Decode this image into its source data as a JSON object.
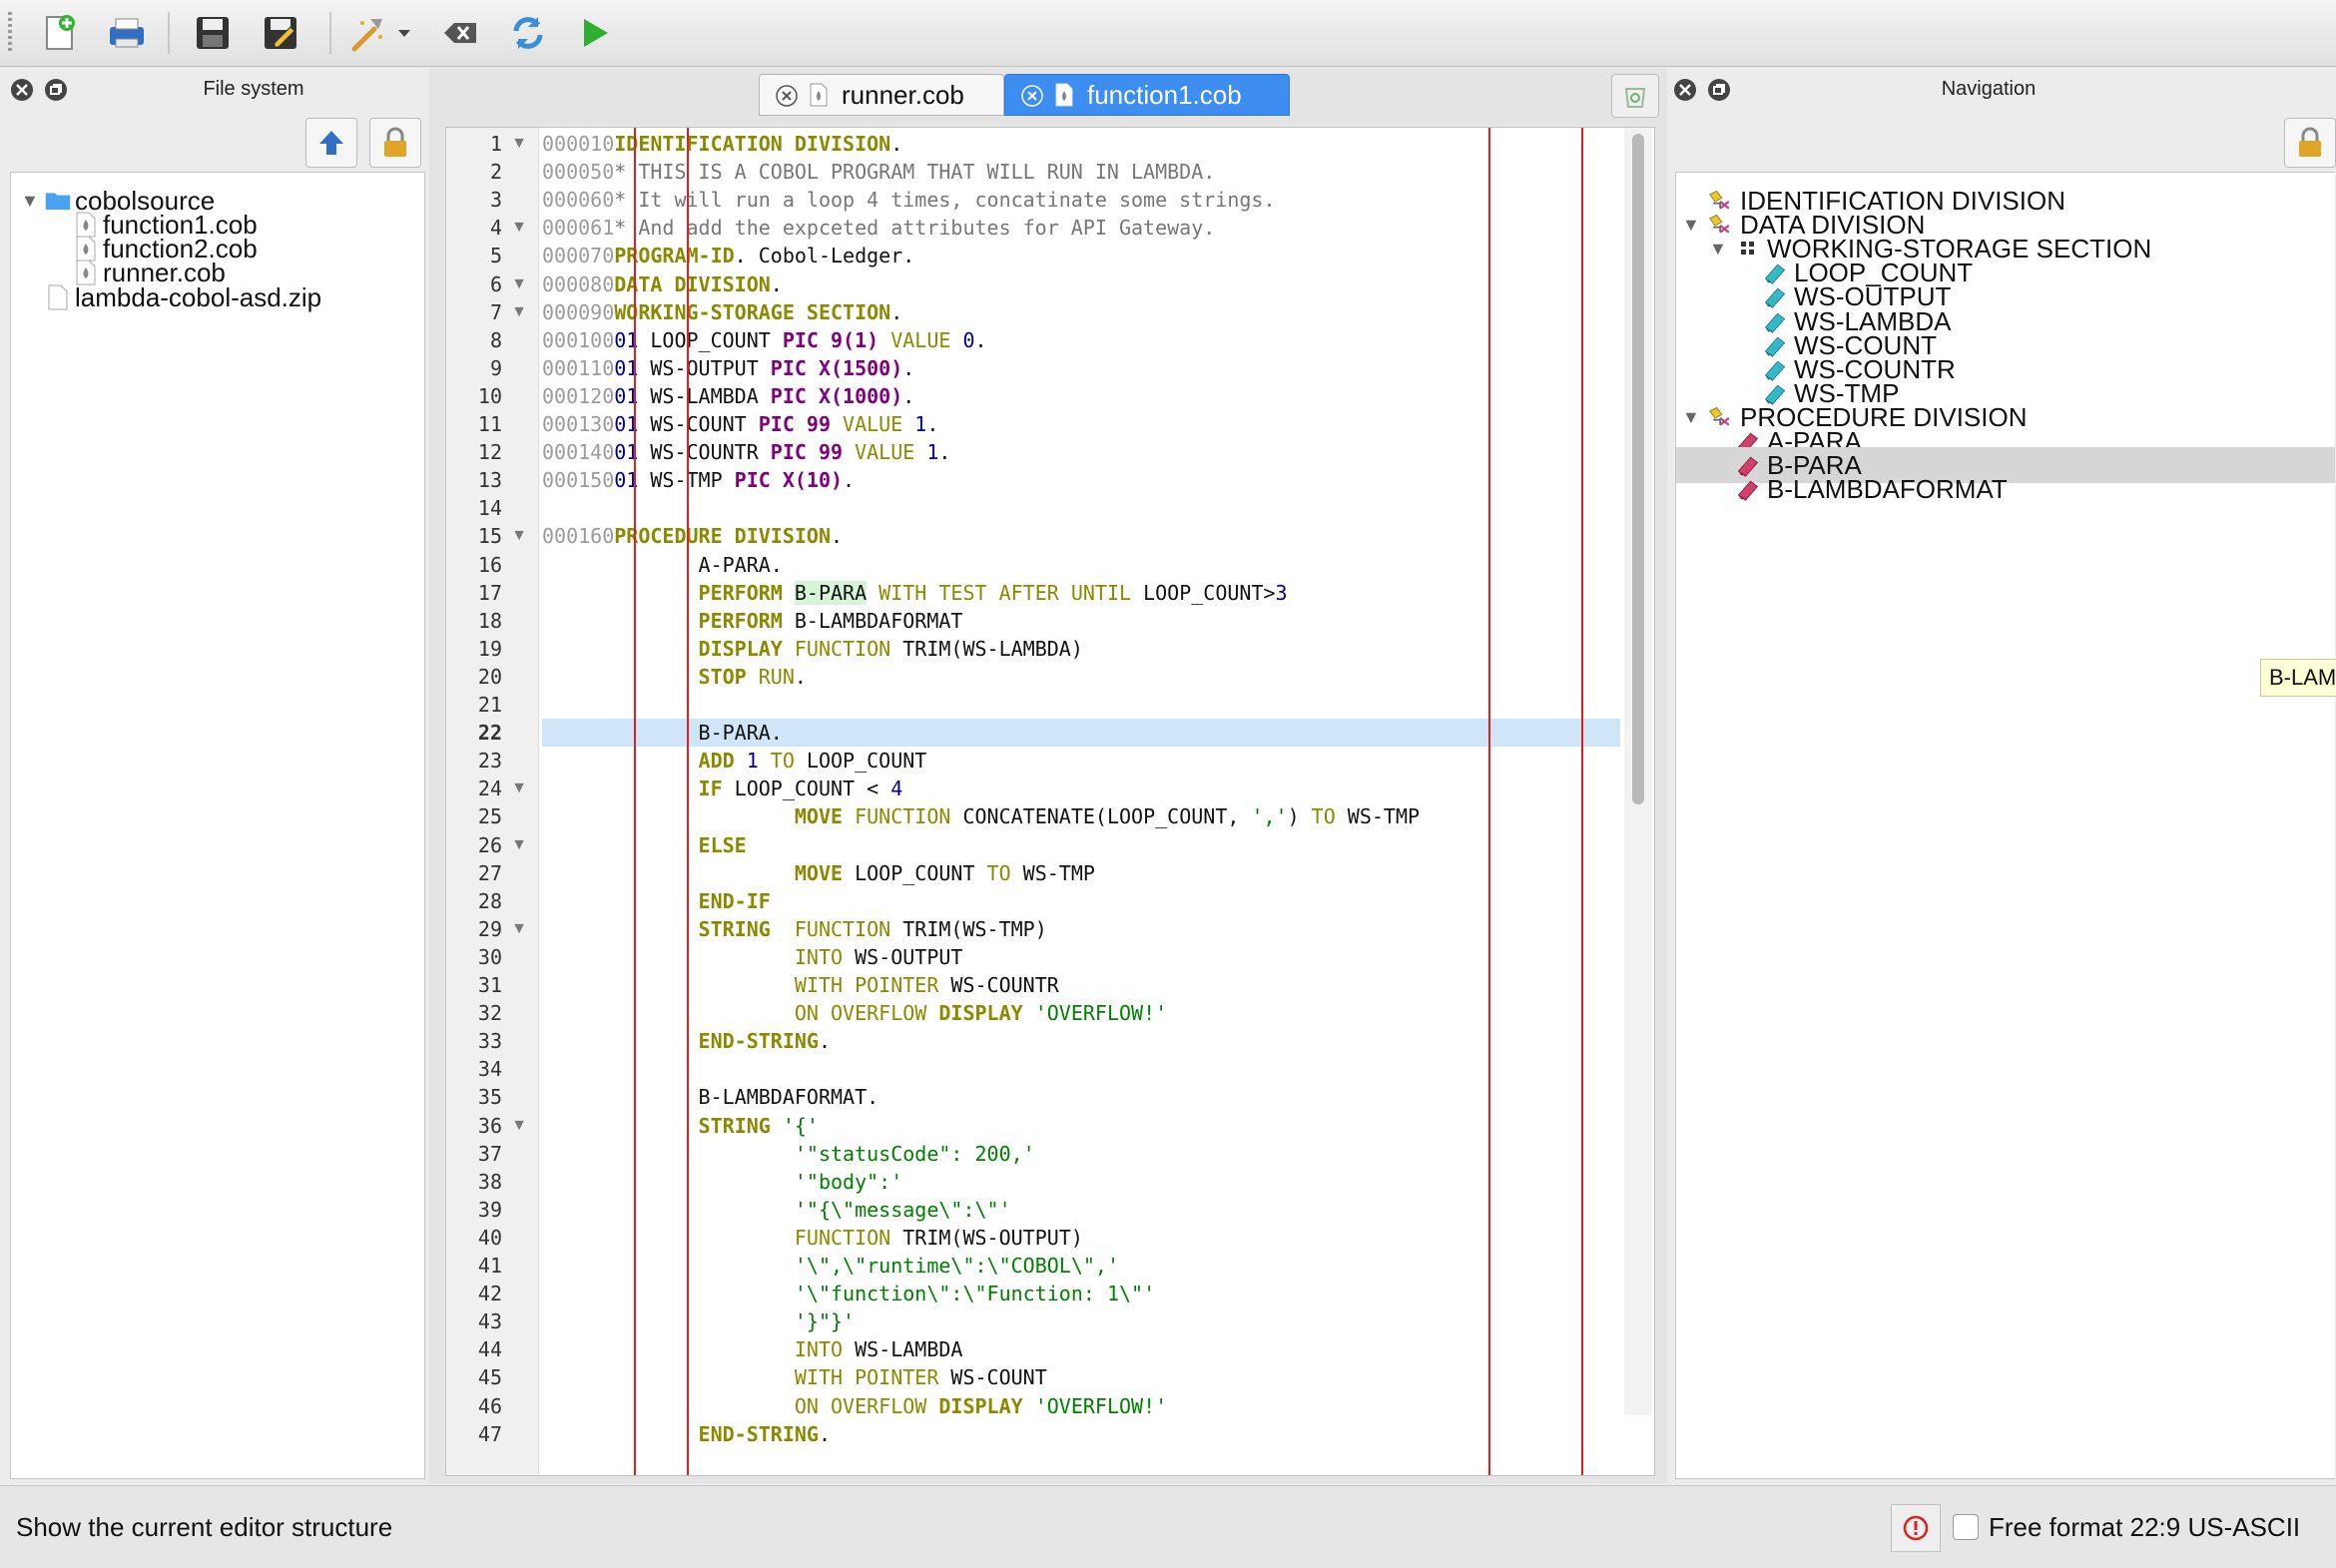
{
  "toolbar": {
    "buttons": [
      "new-file-icon",
      "print-icon",
      "save-icon",
      "save-as-icon",
      "build-icon",
      "dropdown-arrow-icon",
      "clear-icon",
      "refresh-icon",
      "run-icon"
    ]
  },
  "filesystem": {
    "title": "File system",
    "items": [
      {
        "label": "cobolsource",
        "type": "folder",
        "expanded": true,
        "level": 0
      },
      {
        "label": "function1.cob",
        "type": "cobol",
        "level": 1
      },
      {
        "label": "function2.cob",
        "type": "cobol",
        "level": 1
      },
      {
        "label": "runner.cob",
        "type": "cobol",
        "level": 1
      },
      {
        "label": "lambda-cobol-asd.zip",
        "type": "file",
        "level": 0
      }
    ]
  },
  "editor": {
    "tabs": [
      {
        "label": "runner.cob",
        "active": false
      },
      {
        "label": "function1.cob",
        "active": true
      }
    ],
    "current_line": 22,
    "lines": [
      {
        "n": "1",
        "fold": true,
        "seq": "000010",
        "code": [
          [
            "kw",
            "IDENTIFICATION DIVISION"
          ],
          [
            "plain",
            "."
          ]
        ]
      },
      {
        "n": "2",
        "seq": "000050",
        "code": [
          [
            "cm",
            "* THIS IS A COBOL PROGRAM THAT WILL RUN IN LAMBDA."
          ]
        ]
      },
      {
        "n": "3",
        "seq": "000060",
        "code": [
          [
            "cm",
            "* It will run a loop 4 times, concatinate some strings."
          ]
        ]
      },
      {
        "n": "4",
        "fold": true,
        "seq": "000061",
        "code": [
          [
            "cm",
            "* And add the expceted attributes for API Gateway."
          ]
        ]
      },
      {
        "n": "5",
        "seq": "000070",
        "code": [
          [
            "kw",
            "PROGRAM-ID"
          ],
          [
            "plain",
            ". Cobol-Ledger."
          ]
        ]
      },
      {
        "n": "6",
        "fold": true,
        "seq": "000080",
        "code": [
          [
            "kw",
            "DATA DIVISION"
          ],
          [
            "plain",
            "."
          ]
        ]
      },
      {
        "n": "7",
        "fold": true,
        "seq": "000090",
        "code": [
          [
            "kw",
            "WORKING-STORAGE SECTION"
          ],
          [
            "plain",
            "."
          ]
        ]
      },
      {
        "n": "8",
        "seq": "000100",
        "code": [
          [
            "lvl",
            "01"
          ],
          [
            "plain",
            " LOOP_COUNT "
          ],
          [
            "pic",
            "PIC 9(1)"
          ],
          [
            "kw2",
            " VALUE"
          ],
          [
            "num",
            " 0"
          ],
          [
            "plain",
            "."
          ]
        ]
      },
      {
        "n": "9",
        "seq": "000110",
        "code": [
          [
            "lvl",
            "01"
          ],
          [
            "plain",
            " WS-OUTPUT "
          ],
          [
            "pic",
            "PIC X(1500)"
          ],
          [
            "plain",
            "."
          ]
        ]
      },
      {
        "n": "10",
        "seq": "000120",
        "code": [
          [
            "lvl",
            "01"
          ],
          [
            "plain",
            " WS-LAMBDA "
          ],
          [
            "pic",
            "PIC X(1000)"
          ],
          [
            "plain",
            "."
          ]
        ]
      },
      {
        "n": "11",
        "seq": "000130",
        "code": [
          [
            "lvl",
            "01"
          ],
          [
            "plain",
            " WS-COUNT "
          ],
          [
            "pic",
            "PIC 99"
          ],
          [
            "kw2",
            " VALUE"
          ],
          [
            "num",
            " 1"
          ],
          [
            "plain",
            "."
          ]
        ]
      },
      {
        "n": "12",
        "seq": "000140",
        "code": [
          [
            "lvl",
            "01"
          ],
          [
            "plain",
            " WS-COUNTR "
          ],
          [
            "pic",
            "PIC 99"
          ],
          [
            "kw2",
            " VALUE"
          ],
          [
            "num",
            " 1"
          ],
          [
            "plain",
            "."
          ]
        ]
      },
      {
        "n": "13",
        "seq": "000150",
        "code": [
          [
            "lvl",
            "01"
          ],
          [
            "plain",
            " WS-TMP "
          ],
          [
            "pic",
            "PIC X(10)"
          ],
          [
            "plain",
            "."
          ]
        ]
      },
      {
        "n": "14",
        "seq": "",
        "code": []
      },
      {
        "n": "15",
        "fold": true,
        "seq": "000160",
        "code": [
          [
            "kw",
            "PROCEDURE DIVISION"
          ],
          [
            "plain",
            "."
          ]
        ]
      },
      {
        "n": "16",
        "seq": "",
        "code": [
          [
            "plain",
            "       A-PARA."
          ]
        ]
      },
      {
        "n": "17",
        "seq": "",
        "code": [
          [
            "plain",
            "       "
          ],
          [
            "kw",
            "PERFORM"
          ],
          [
            "plain",
            " "
          ],
          [
            "hl",
            "B-PARA"
          ],
          [
            "kw2",
            " WITH TEST AFTER UNTIL"
          ],
          [
            "plain",
            " LOOP_COUNT>"
          ],
          [
            "num",
            "3"
          ]
        ]
      },
      {
        "n": "18",
        "seq": "",
        "code": [
          [
            "plain",
            "       "
          ],
          [
            "kw",
            "PERFORM"
          ],
          [
            "plain",
            " B-LAMBDAFORMAT"
          ]
        ]
      },
      {
        "n": "19",
        "seq": "",
        "code": [
          [
            "plain",
            "       "
          ],
          [
            "kw",
            "DISPLAY"
          ],
          [
            "kw2",
            " FUNCTION"
          ],
          [
            "plain",
            " TRIM(WS-LAMBDA)"
          ]
        ]
      },
      {
        "n": "20",
        "seq": "",
        "code": [
          [
            "plain",
            "       "
          ],
          [
            "kw",
            "STOP"
          ],
          [
            "kw2",
            " RUN"
          ],
          [
            "plain",
            "."
          ]
        ]
      },
      {
        "n": "21",
        "seq": "",
        "code": []
      },
      {
        "n": "22",
        "seq": "",
        "code": [
          [
            "plain",
            "       B-PARA."
          ]
        ]
      },
      {
        "n": "23",
        "seq": "",
        "code": [
          [
            "plain",
            "       "
          ],
          [
            "kw",
            "ADD"
          ],
          [
            "num",
            " 1"
          ],
          [
            "kw2",
            " TO"
          ],
          [
            "plain",
            " LOOP_COUNT"
          ]
        ]
      },
      {
        "n": "24",
        "fold": true,
        "seq": "",
        "code": [
          [
            "plain",
            "       "
          ],
          [
            "kw",
            "IF"
          ],
          [
            "plain",
            " LOOP_COUNT < "
          ],
          [
            "num",
            "4"
          ]
        ]
      },
      {
        "n": "25",
        "seq": "",
        "code": [
          [
            "plain",
            "               "
          ],
          [
            "kw",
            "MOVE"
          ],
          [
            "kw2",
            " FUNCTION"
          ],
          [
            "plain",
            " CONCATENATE(LOOP_COUNT, "
          ],
          [
            "str",
            "','"
          ],
          [
            "plain",
            ")"
          ],
          [
            "kw2",
            " TO"
          ],
          [
            "plain",
            " WS-TMP"
          ]
        ]
      },
      {
        "n": "26",
        "fold": true,
        "seq": "",
        "code": [
          [
            "plain",
            "       "
          ],
          [
            "kw",
            "ELSE"
          ]
        ]
      },
      {
        "n": "27",
        "seq": "",
        "code": [
          [
            "plain",
            "               "
          ],
          [
            "kw",
            "MOVE"
          ],
          [
            "plain",
            " LOOP_COUNT"
          ],
          [
            "kw2",
            " TO"
          ],
          [
            "plain",
            " WS-TMP"
          ]
        ]
      },
      {
        "n": "28",
        "seq": "",
        "code": [
          [
            "plain",
            "       "
          ],
          [
            "kw",
            "END-IF"
          ]
        ]
      },
      {
        "n": "29",
        "fold": true,
        "seq": "",
        "code": [
          [
            "plain",
            "       "
          ],
          [
            "kw",
            "STRING"
          ],
          [
            "kw2",
            "  FUNCTION"
          ],
          [
            "plain",
            " TRIM(WS-TMP)"
          ]
        ]
      },
      {
        "n": "30",
        "seq": "",
        "code": [
          [
            "plain",
            "               "
          ],
          [
            "kw2",
            "INTO"
          ],
          [
            "plain",
            " WS-OUTPUT"
          ]
        ]
      },
      {
        "n": "31",
        "seq": "",
        "code": [
          [
            "plain",
            "               "
          ],
          [
            "kw2",
            "WITH POINTER"
          ],
          [
            "plain",
            " WS-COUNTR"
          ]
        ]
      },
      {
        "n": "32",
        "seq": "",
        "code": [
          [
            "plain",
            "               "
          ],
          [
            "kw2",
            "ON OVERFLOW"
          ],
          [
            "kw",
            " DISPLAY"
          ],
          [
            "str",
            " 'OVERFLOW!'"
          ]
        ]
      },
      {
        "n": "33",
        "seq": "",
        "code": [
          [
            "plain",
            "       "
          ],
          [
            "kw",
            "END-STRING"
          ],
          [
            "plain",
            "."
          ]
        ]
      },
      {
        "n": "34",
        "seq": "",
        "code": []
      },
      {
        "n": "35",
        "seq": "",
        "code": [
          [
            "plain",
            "       B-LAMBDAFORMAT."
          ]
        ]
      },
      {
        "n": "36",
        "fold": true,
        "seq": "",
        "code": [
          [
            "plain",
            "       "
          ],
          [
            "kw",
            "STRING"
          ],
          [
            "str",
            " '{'"
          ]
        ]
      },
      {
        "n": "37",
        "seq": "",
        "code": [
          [
            "plain",
            "               "
          ],
          [
            "str",
            "'\"statusCode\": 200,'"
          ]
        ]
      },
      {
        "n": "38",
        "seq": "",
        "code": [
          [
            "plain",
            "               "
          ],
          [
            "str",
            "'\"body\":'"
          ]
        ]
      },
      {
        "n": "39",
        "seq": "",
        "code": [
          [
            "plain",
            "               "
          ],
          [
            "str",
            "'\"{\\\"message\\\":\\\"'"
          ]
        ]
      },
      {
        "n": "40",
        "seq": "",
        "code": [
          [
            "plain",
            "               "
          ],
          [
            "kw2",
            "FUNCTION"
          ],
          [
            "plain",
            " TRIM(WS-OUTPUT)"
          ]
        ]
      },
      {
        "n": "41",
        "seq": "",
        "code": [
          [
            "plain",
            "               "
          ],
          [
            "str",
            "'\\\",\\\"runtime\\\":\\\"COBOL\\\",'"
          ]
        ]
      },
      {
        "n": "42",
        "seq": "",
        "code": [
          [
            "plain",
            "               "
          ],
          [
            "str",
            "'\\\"function\\\":\\\"Function: 1\\\"'"
          ]
        ]
      },
      {
        "n": "43",
        "seq": "",
        "code": [
          [
            "plain",
            "               "
          ],
          [
            "str",
            "'}\"}'"
          ]
        ]
      },
      {
        "n": "44",
        "seq": "",
        "code": [
          [
            "plain",
            "               "
          ],
          [
            "kw2",
            "INTO"
          ],
          [
            "plain",
            " WS-LAMBDA"
          ]
        ]
      },
      {
        "n": "45",
        "seq": "",
        "code": [
          [
            "plain",
            "               "
          ],
          [
            "kw2",
            "WITH POINTER"
          ],
          [
            "plain",
            " WS-COUNT"
          ]
        ]
      },
      {
        "n": "46",
        "seq": "",
        "code": [
          [
            "plain",
            "               "
          ],
          [
            "kw2",
            "ON OVERFLOW"
          ],
          [
            "kw",
            " DISPLAY"
          ],
          [
            "str",
            " 'OVERFLOW!'"
          ]
        ]
      },
      {
        "n": "47",
        "seq": "",
        "code": [
          [
            "plain",
            "       "
          ],
          [
            "kw",
            "END-STRING"
          ],
          [
            "plain",
            "."
          ]
        ]
      }
    ]
  },
  "navigation": {
    "title": "Navigation",
    "tooltip": "B-LAM",
    "selected": "B-PARA",
    "items": [
      {
        "label": "IDENTIFICATION DIVISION",
        "type": "division",
        "level": 0,
        "twisty": false
      },
      {
        "label": "DATA DIVISION",
        "type": "division",
        "level": 0,
        "twisty": true
      },
      {
        "label": "WORKING-STORAGE SECTION",
        "type": "section",
        "level": 1,
        "twisty": true
      },
      {
        "label": "LOOP_COUNT",
        "type": "variable",
        "level": 2
      },
      {
        "label": "WS-OUTPUT",
        "type": "variable",
        "level": 2
      },
      {
        "label": "WS-LAMBDA",
        "type": "variable",
        "level": 2
      },
      {
        "label": "WS-COUNT",
        "type": "variable",
        "level": 2
      },
      {
        "label": "WS-COUNTR",
        "type": "variable",
        "level": 2
      },
      {
        "label": "WS-TMP",
        "type": "variable",
        "level": 2
      },
      {
        "label": "PROCEDURE DIVISION",
        "type": "division",
        "level": 0,
        "twisty": true
      },
      {
        "label": "A-PARA",
        "type": "paragraph",
        "level": 1
      },
      {
        "label": "B-PARA",
        "type": "paragraph",
        "level": 1
      },
      {
        "label": "B-LAMBDAFORMAT",
        "type": "paragraph",
        "level": 1
      }
    ]
  },
  "status": {
    "message": "Show the current editor structure",
    "format": "Free format",
    "position": "22:9",
    "encoding": "US-ASCII"
  },
  "colors": {
    "accent": "#3d8ef0",
    "keyword": "#8a8a00",
    "pic": "#800080",
    "string": "#008000",
    "current_line": "#cfe6f8",
    "margin_line": "#e02020"
  }
}
